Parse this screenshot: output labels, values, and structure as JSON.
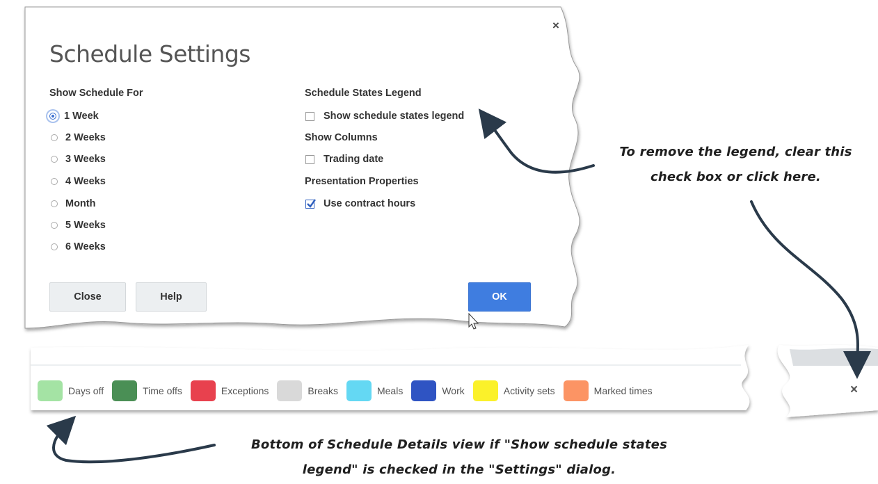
{
  "dialog": {
    "title": "Schedule Settings",
    "close_glyph": "×",
    "show_schedule_for": {
      "heading": "Show Schedule For",
      "options": [
        "1 Week",
        "2 Weeks",
        "3 Weeks",
        "4 Weeks",
        "Month",
        "5 Weeks",
        "6 Weeks"
      ],
      "selected": "1 Week"
    },
    "schedule_states_legend": {
      "heading": "Schedule States Legend",
      "checkbox_label": "Show schedule states legend",
      "checked": false
    },
    "show_columns": {
      "heading": "Show Columns",
      "checkbox_label": "Trading date",
      "checked": false
    },
    "presentation_properties": {
      "heading": "Presentation Properties",
      "checkbox_label": "Use contract hours",
      "checked": true
    },
    "buttons": {
      "close": "Close",
      "help": "Help",
      "ok": "OK"
    }
  },
  "legend_bar": {
    "items": [
      {
        "label": "Days off",
        "color": "#a4e3a4"
      },
      {
        "label": "Time offs",
        "color": "#4a8f55"
      },
      {
        "label": "Exceptions",
        "color": "#e8414e"
      },
      {
        "label": "Breaks",
        "color": "#d9d9d9"
      },
      {
        "label": "Meals",
        "color": "#64d8f3"
      },
      {
        "label": "Work",
        "color": "#2f54c3"
      },
      {
        "label": "Activity sets",
        "color": "#fbf12a"
      },
      {
        "label": "Marked times",
        "color": "#fc9464"
      }
    ],
    "close_glyph": "×"
  },
  "annotations": {
    "right_line1": "To remove the legend, clear this",
    "right_line2": "check box or click here.",
    "bottom_line1": "Bottom of Schedule Details view if \"Show schedule states",
    "bottom_line2": "legend\" is checked in the \"Settings\" dialog."
  },
  "colors": {
    "accent": "#3f7de0",
    "checkbox_check": "#2e5fbf",
    "annotation_arrow": "#2a3a4a"
  }
}
